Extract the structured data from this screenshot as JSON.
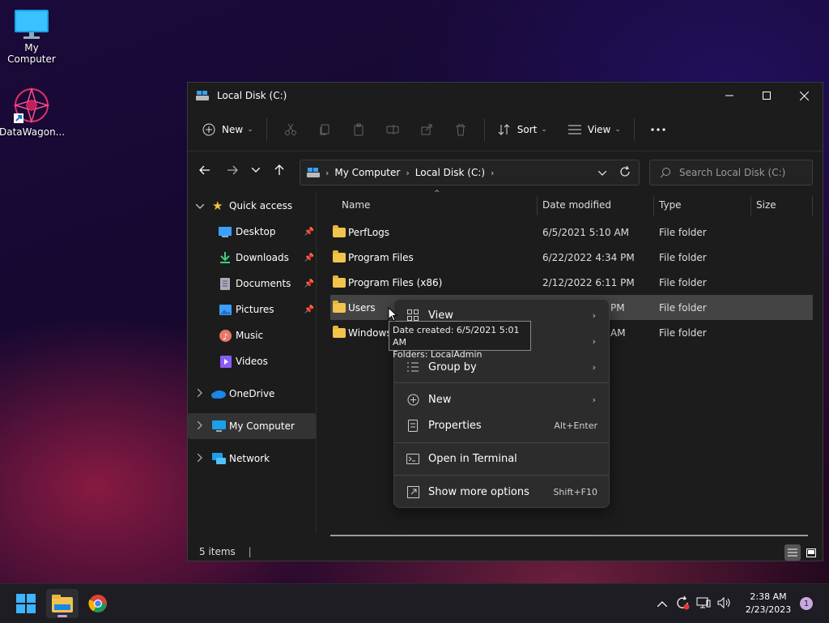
{
  "desktop": {
    "icons": [
      {
        "label": "My Computer"
      },
      {
        "label": "DataWagon..."
      }
    ]
  },
  "window": {
    "title": "Local Disk (C:)",
    "toolbar": {
      "new_label": "New",
      "sort_label": "Sort",
      "view_label": "View"
    },
    "address": {
      "crumbs": [
        "My Computer",
        "Local Disk (C:)"
      ]
    },
    "search": {
      "placeholder": "Search Local Disk (C:)"
    },
    "sidebar": {
      "quick_access": "Quick access",
      "items": [
        {
          "label": "Desktop"
        },
        {
          "label": "Downloads"
        },
        {
          "label": "Documents"
        },
        {
          "label": "Pictures"
        },
        {
          "label": "Music"
        },
        {
          "label": "Videos"
        }
      ],
      "onedrive": "OneDrive",
      "my_computer": "My Computer",
      "network": "Network"
    },
    "columns": {
      "name": "Name",
      "date": "Date modified",
      "type": "Type",
      "size": "Size"
    },
    "rows": [
      {
        "name": "PerfLogs",
        "date": "6/5/2021 5:10 AM",
        "type": "File folder"
      },
      {
        "name": "Program Files",
        "date": "6/22/2022 4:34 PM",
        "type": "File folder"
      },
      {
        "name": "Program Files (x86)",
        "date": "2/12/2022 6:11 PM",
        "type": "File folder"
      },
      {
        "name": "Users",
        "date": "PM",
        "type": "File folder"
      },
      {
        "name": "Windows",
        "date": "AM",
        "type": "File folder"
      }
    ],
    "status": "5 items"
  },
  "context_menu": {
    "view": "View",
    "group_by": "Group by",
    "new": "New",
    "properties": "Properties",
    "properties_shortcut": "Alt+Enter",
    "open_terminal": "Open in Terminal",
    "more_options": "Show more options",
    "more_options_shortcut": "Shift+F10"
  },
  "tooltip": {
    "line1": "Date created: 6/5/2021 5:01 AM",
    "line2": "Folders: LocalAdmin"
  },
  "taskbar": {
    "time": "2:38 AM",
    "date": "2/23/2023",
    "notification_count": "1"
  },
  "colors": {
    "accent": "#0078d4",
    "folder": "#f2c34d",
    "selection": "#444444"
  }
}
